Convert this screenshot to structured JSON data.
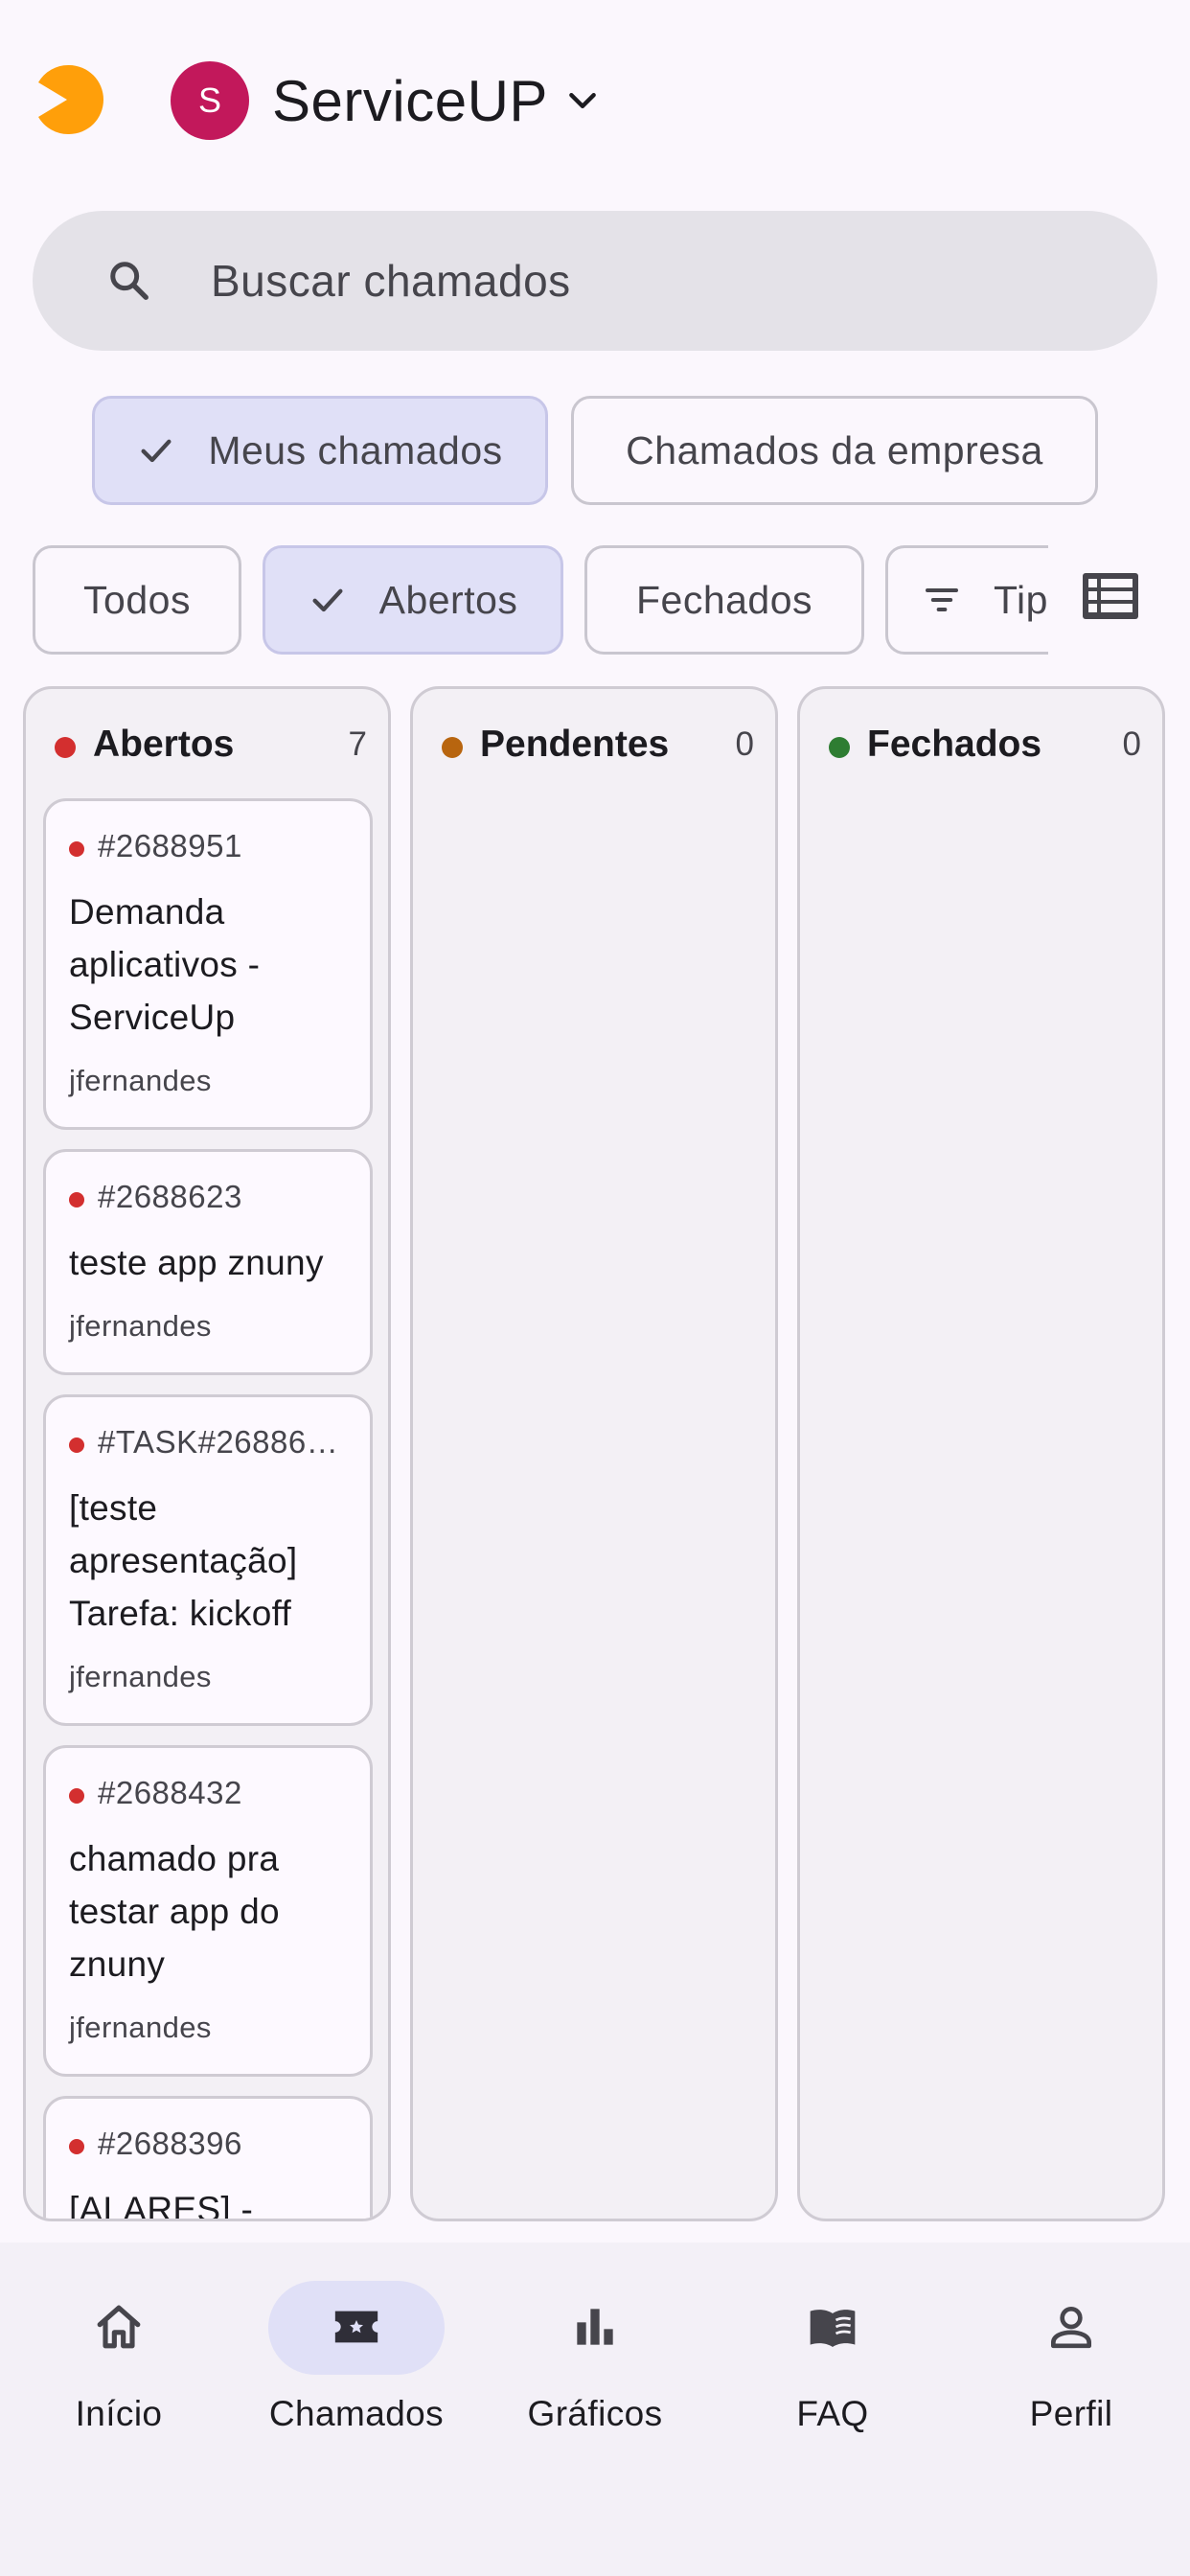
{
  "header": {
    "avatar_letter": "S",
    "org_name": "ServiceUP"
  },
  "search": {
    "placeholder": "Buscar chamados"
  },
  "scope_chips": [
    {
      "label": "Meus chamados",
      "selected": true
    },
    {
      "label": "Chamados da empresa",
      "selected": false
    }
  ],
  "status_chips": [
    {
      "label": "Todos",
      "selected": false
    },
    {
      "label": "Abertos",
      "selected": true
    },
    {
      "label": "Fechados",
      "selected": false
    },
    {
      "label": "Tip",
      "selected": false
    }
  ],
  "columns": [
    {
      "title": "Abertos",
      "count": "7",
      "dot_color": "#d32f2f",
      "cards": [
        {
          "id": "#2688951",
          "title": "Demanda aplicativos - ServiceUp",
          "user": "jfernandes"
        },
        {
          "id": "#2688623",
          "title": "teste app znuny",
          "user": "jfernandes"
        },
        {
          "id": "#TASK#26886…",
          "title": "[teste apresentação] Tarefa: kickoff",
          "user": "jfernandes"
        },
        {
          "id": "#2688432",
          "title": "chamado pra testar app do znuny",
          "user": "jfernandes"
        },
        {
          "id": "#2688396",
          "title": "[ALARES] -",
          "user": ""
        }
      ]
    },
    {
      "title": "Pendentes",
      "count": "0",
      "dot_color": "#b8650f",
      "cards": []
    },
    {
      "title": "Fechados",
      "count": "0",
      "dot_color": "#2e7d32",
      "cards": []
    }
  ],
  "nav": [
    {
      "label": "Início",
      "icon": "home-icon",
      "active": false
    },
    {
      "label": "Chamados",
      "icon": "ticket-icon",
      "active": true
    },
    {
      "label": "Gráficos",
      "icon": "bar-chart-icon",
      "active": false
    },
    {
      "label": "FAQ",
      "icon": "book-icon",
      "active": false
    },
    {
      "label": "Perfil",
      "icon": "person-icon",
      "active": false
    }
  ],
  "colors": {
    "accent": "#e0e0f7",
    "avatar": "#c2185b",
    "logo": "#ff9f0a"
  }
}
